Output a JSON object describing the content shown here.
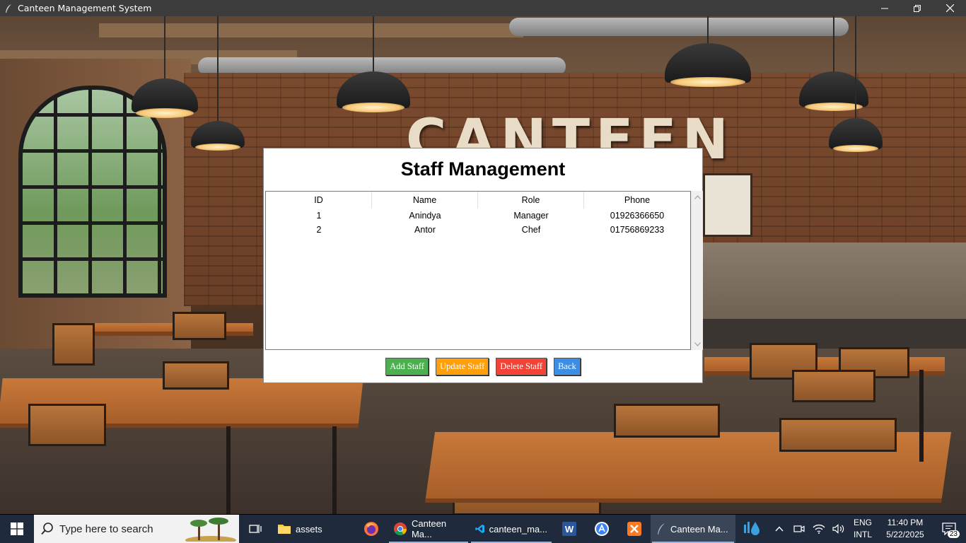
{
  "window": {
    "title": "Canteen Management System",
    "icons": [
      "feather-icon",
      "minimize-icon",
      "maximize-icon",
      "close-icon"
    ]
  },
  "background": {
    "sign_text": "CANTEEN"
  },
  "dialog": {
    "title": "Staff Management",
    "columns": [
      "ID",
      "Name",
      "Role",
      "Phone"
    ],
    "rows": [
      {
        "id": "1",
        "name": "Anindya",
        "role": "Manager",
        "phone": "01926366650"
      },
      {
        "id": "2",
        "name": "Antor",
        "role": "Chef",
        "phone": "01756869233"
      }
    ],
    "buttons": {
      "add": "Add Staff",
      "update": "Update Staff",
      "delete": "Delete Staff",
      "back": "Back"
    },
    "colors": {
      "add": "#4caf50",
      "update": "#ff9f0a",
      "delete": "#f44336",
      "back": "#3b8ee6"
    }
  },
  "taskbar": {
    "search_placeholder": "Type here to search",
    "apps": [
      {
        "label": "assets",
        "icon": "folder-icon"
      },
      {
        "label": "",
        "icon": "firefox-icon"
      },
      {
        "label": "Canteen Ma...",
        "icon": "chrome-icon"
      },
      {
        "label": "canteen_ma...",
        "icon": "vscode-icon"
      },
      {
        "label": "",
        "icon": "word-icon"
      },
      {
        "label": "",
        "icon": "app-store-icon"
      },
      {
        "label": "",
        "icon": "xampp-icon"
      },
      {
        "label": "Canteen Ma...",
        "icon": "feather-icon",
        "active": true
      }
    ],
    "language": {
      "line1": "ENG",
      "line2": "INTL"
    },
    "clock": {
      "time": "11:40 PM",
      "date": "5/22/2025"
    },
    "notifications": "23"
  }
}
